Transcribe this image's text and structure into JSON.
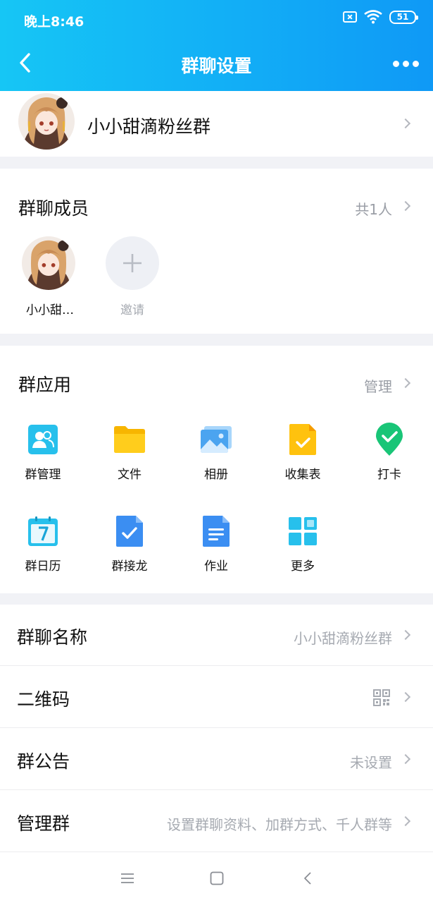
{
  "status": {
    "time": "晚上8:46",
    "battery": "51"
  },
  "header": {
    "title": "群聊设置"
  },
  "group": {
    "name": "小小甜滴粉丝群"
  },
  "members": {
    "title": "群聊成员",
    "count": "共1人",
    "items": [
      {
        "name": "小小甜…"
      }
    ],
    "invite_label": "邀请"
  },
  "apps": {
    "title": "群应用",
    "manage": "管理",
    "items": [
      {
        "label": "群管理",
        "icon": "group-manage-icon"
      },
      {
        "label": "文件",
        "icon": "folder-icon"
      },
      {
        "label": "相册",
        "icon": "album-icon"
      },
      {
        "label": "收集表",
        "icon": "form-icon"
      },
      {
        "label": "打卡",
        "icon": "checkin-icon"
      },
      {
        "label": "群日历",
        "icon": "calendar-icon"
      },
      {
        "label": "群接龙",
        "icon": "relay-icon"
      },
      {
        "label": "作业",
        "icon": "homework-icon"
      },
      {
        "label": "更多",
        "icon": "more-apps-icon"
      }
    ]
  },
  "settings": {
    "name_label": "群聊名称",
    "name_value": "小小甜滴粉丝群",
    "qr_label": "二维码",
    "notice_label": "群公告",
    "notice_value": "未设置",
    "manage_label": "管理群",
    "manage_value": "设置群聊资料、加群方式、千人群等"
  },
  "colors": {
    "header_start": "#16c6f5",
    "header_end": "#0f99f6",
    "muted": "#a6aab1"
  }
}
